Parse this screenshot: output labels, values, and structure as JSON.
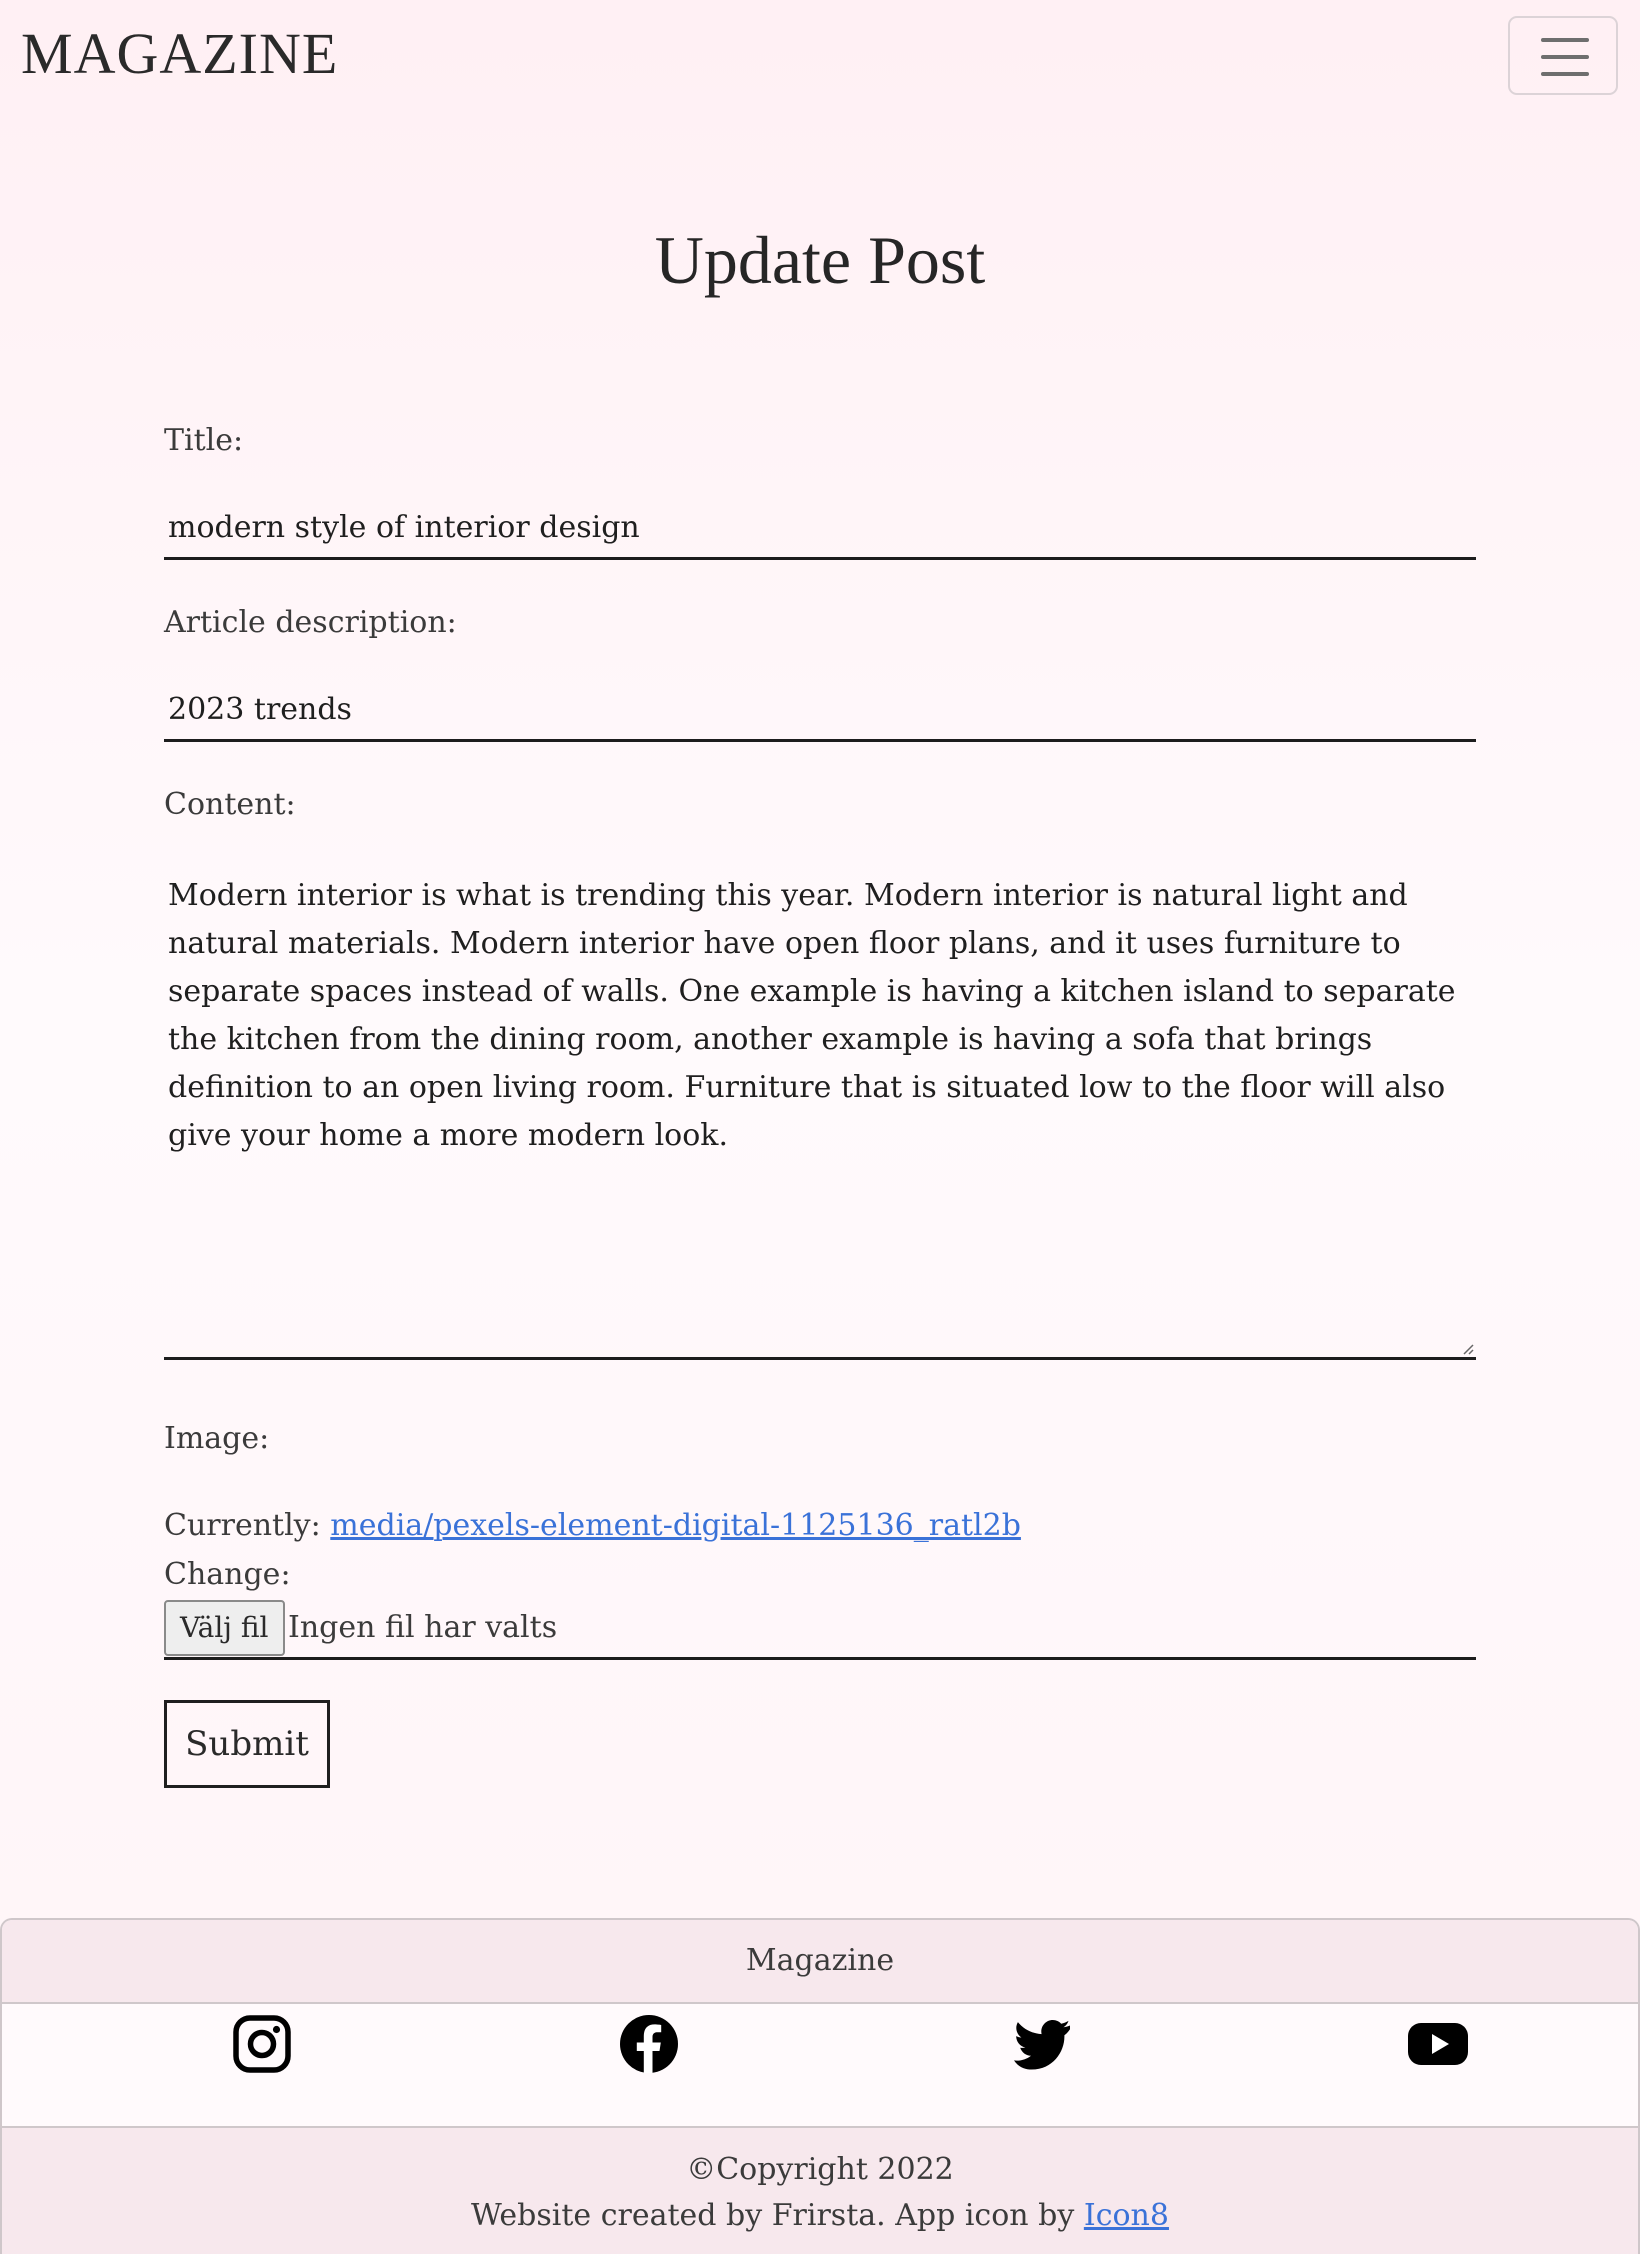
{
  "navbar": {
    "brand": "MAGAZINE",
    "menu_icon": "hamburger-menu-icon"
  },
  "page": {
    "title": "Update Post"
  },
  "form": {
    "title_label": "Title:",
    "title_value": "modern style of interior design",
    "description_label": "Article description:",
    "description_value": "2023 trends",
    "content_label": "Content:",
    "content_value": "Modern interior is what is trending this year. Modern interior is natural light and natural materials. Modern interior have open floor plans, and it uses furniture to separate spaces instead of walls. One example is having a kitchen island to separate the kitchen from the dining room, another example is having a sofa that brings definition to an open living room. Furniture that is situated low to the floor will also give your home a more modern look.",
    "image_label": "Image:",
    "currently_label": "Currently:",
    "current_image_link": "media/pexels-element-digital-1125136_ratl2b",
    "change_label": "Change:",
    "file_button_label": "Välj fil",
    "file_status": "Ingen fil har valts",
    "submit_label": "Submit"
  },
  "footer": {
    "title": "Magazine",
    "social_icons": [
      "instagram-icon",
      "facebook-icon",
      "twitter-icon",
      "youtube-icon"
    ],
    "copyright": "©Copyright 2022",
    "credit_text": "Website created by Frirsta. App icon by ",
    "credit_link": "Icon8"
  },
  "colors": {
    "background": "#fff0f4",
    "footer_band": "#f7e8ed",
    "link": "#3a72d8",
    "text": "#212121"
  }
}
